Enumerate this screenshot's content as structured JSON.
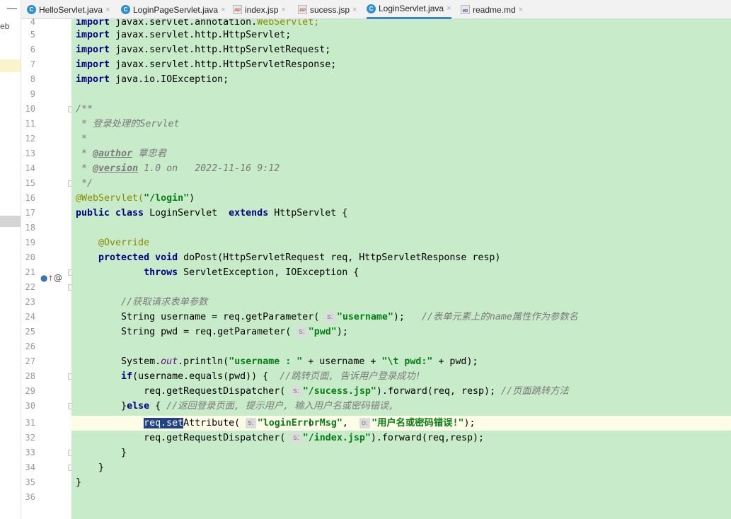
{
  "project": {
    "partial_label": "eb"
  },
  "tabs": [
    {
      "label": "HelloServlet.java",
      "type": "class",
      "active": false
    },
    {
      "label": "LoginPageServlet.java",
      "type": "class",
      "active": false
    },
    {
      "label": "index.jsp",
      "type": "jsp",
      "active": false
    },
    {
      "label": "sucess.jsp",
      "type": "jsp",
      "active": false
    },
    {
      "label": "LoginServlet.java",
      "type": "class",
      "active": true
    },
    {
      "label": "readme.md",
      "type": "md",
      "active": false
    }
  ],
  "editor": {
    "line_numbers": [
      "4",
      "5",
      "6",
      "7",
      "8",
      "9",
      "10",
      "11",
      "12",
      "13",
      "14",
      "15",
      "16",
      "17",
      "18",
      "19",
      "20",
      "21",
      "22",
      "23",
      "24",
      "25",
      "26",
      "27",
      "28",
      "29",
      "30",
      "31",
      "32",
      "33",
      "34",
      "35",
      "36"
    ],
    "current_line": "31",
    "lines": {
      "l4a": "import ",
      "l4b": "javax.servlet.annotation.",
      "l4c": "WebServlet;",
      "l5a": "import ",
      "l5b": "javax.servlet.http.HttpServlet;",
      "l6a": "import ",
      "l6b": "javax.servlet.http.HttpServletRequest;",
      "l7a": "import ",
      "l7b": "javax.servlet.http.HttpServletResponse;",
      "l8a": "import ",
      "l8b": "java.io.IOException;",
      "l10": "/**",
      "l11": " * 登录处理的Servlet",
      "l12": " *",
      "l13a": " * ",
      "l13b": "@author",
      "l13c": " 覃忠君",
      "l14a": " * ",
      "l14b": "@version",
      "l14c": " 1.0 on   2022-11-16 9:12",
      "l15": " */",
      "l16a": "@WebServlet(",
      "l16b": "\"/login\"",
      "l16c": ")",
      "l17a": "public class ",
      "l17b": "LoginServlet  ",
      "l17c": "extends ",
      "l17d": "HttpServlet {",
      "l19": "    @Override",
      "l20a": "    protected void ",
      "l20b": "doPost(HttpServletRequest req, HttpServletResponse resp)",
      "l21a": "            throws ",
      "l21b": "ServletException, IOException {",
      "l23": "        //获取请求表单参数",
      "l24a": "        String username = req.getParameter( ",
      "l24h": "s:",
      "l24b": "\"username\"",
      "l24c": ");   ",
      "l24d": "//表单元素上的name属性作为参数名",
      "l25a": "        String pwd = req.getParameter( ",
      "l25h": "s:",
      "l25b": "\"pwd\"",
      "l25c": ");",
      "l27a": "        System.",
      "l27b": "out",
      "l27c": ".println(",
      "l27d": "\"username : \"",
      "l27e": " + username + ",
      "l27f": "\"\\t pwd:\"",
      "l27g": " + pwd);",
      "l28a": "        ",
      "l28b": "if",
      "l28c": "(username.equals(pwd)) {  ",
      "l28d": "//跳转页面, 告诉用户登录成功!",
      "l29a": "            req.getRequestDispatcher( ",
      "l29h": "s:",
      "l29b": "\"/sucess.jsp\"",
      "l29c": ").forward(req, resp); ",
      "l29d": "//页面跳转方法",
      "l30a": "        }",
      "l30b": "else",
      "l30c": " { ",
      "l30d": "//返回登录页面, 提示用户, 输入用户名或密码错误,",
      "l31a": "            ",
      "l31s": "req.set",
      "l31b": "Attribute( ",
      "l31h1": "s:",
      "l31c": "\"loginErrorMsg\"",
      "l31d": ",  ",
      "l31h2": "o:",
      "l31e": "\"用户名或密码错误!\"",
      "l31f": ");",
      "l32a": "            req.getRequestDispatcher( ",
      "l32h": "s:",
      "l32b": "\"/index.jsp\"",
      "l32c": ").forward(req,resp);",
      "l33": "        }",
      "l34": "    }",
      "l35": "}"
    }
  },
  "colors": {
    "editor_background": "#c8ebca",
    "keyword": "#000080",
    "string": "#067d17",
    "comment": "#7a7a7a",
    "annotation": "#8a8a00",
    "active_tab_underline": "#4083c9",
    "selection": "#214283",
    "current_line": "#fcfce7"
  }
}
